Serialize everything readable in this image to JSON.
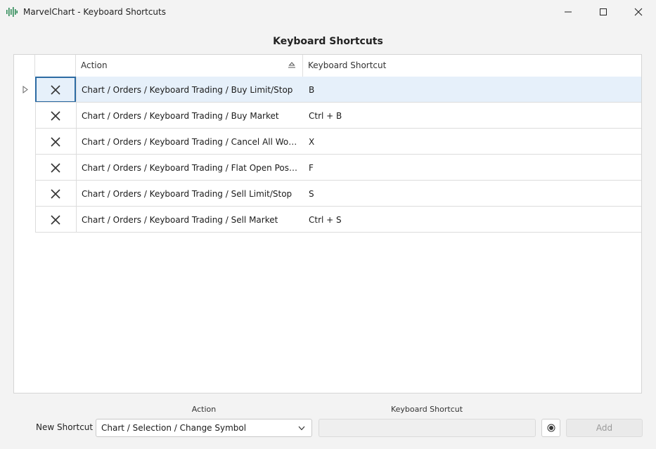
{
  "window": {
    "title": "MarvelChart - Keyboard Shortcuts",
    "app_icon": "waveform-icon",
    "controls": [
      "minimize-icon",
      "maximize-icon",
      "close-icon"
    ]
  },
  "heading": "Keyboard Shortcuts",
  "table": {
    "columns": [
      "",
      "",
      "Action",
      "Keyboard Shortcut"
    ],
    "sort_column": "Action",
    "rows": [
      {
        "action": "Chart / Orders / Keyboard Trading / Buy Limit/Stop",
        "shortcut": "B",
        "selected": true
      },
      {
        "action": "Chart / Orders / Keyboard Trading / Buy Market",
        "shortcut": "Ctrl + B"
      },
      {
        "action": "Chart / Orders / Keyboard Trading / Cancel All Workin...",
        "shortcut": "X"
      },
      {
        "action": "Chart / Orders / Keyboard Trading / Flat Open Position",
        "shortcut": "F"
      },
      {
        "action": "Chart / Orders / Keyboard Trading / Sell Limit/Stop",
        "shortcut": "S"
      },
      {
        "action": "Chart / Orders / Keyboard Trading / Sell Market",
        "shortcut": "Ctrl + S"
      }
    ]
  },
  "footer": {
    "action_label": "Action",
    "shortcut_label": "Keyboard Shortcut",
    "new_shortcut_label": "New Shortcut",
    "selected_action": "Chart / Selection / Change Symbol",
    "shortcut_value": "",
    "shortcut_placeholder": "",
    "add_label": "Add"
  },
  "colors": {
    "selected_row": "#e6f0fa",
    "focus_border": "#2c6ba3",
    "app_icon": "#2e8b57"
  }
}
